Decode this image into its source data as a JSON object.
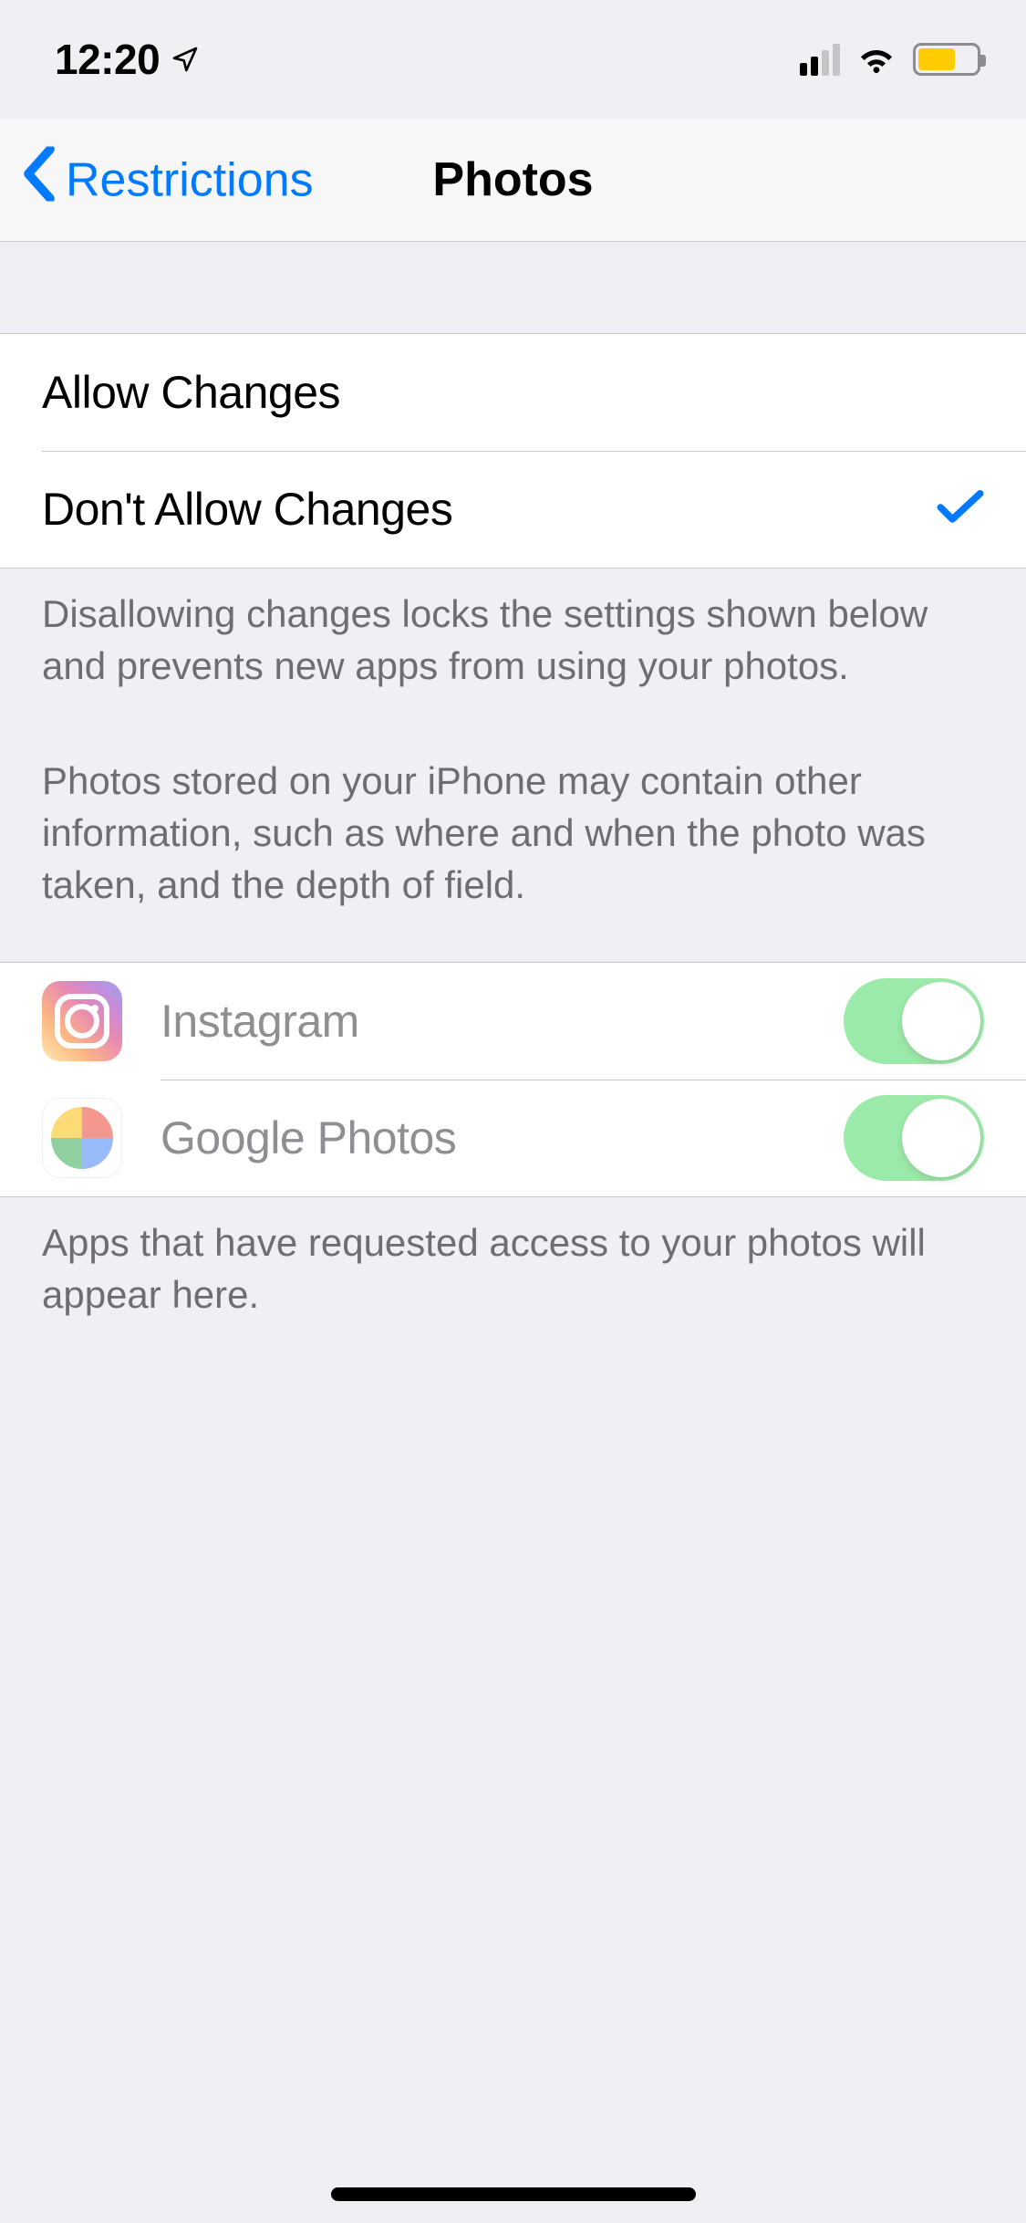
{
  "status": {
    "time": "12:20",
    "location_icon": "navigation-arrow",
    "signal_bars": 2,
    "wifi": true,
    "battery_state": "low-power"
  },
  "nav": {
    "back_label": "Restrictions",
    "title": "Photos"
  },
  "changes": {
    "allow_label": "Allow Changes",
    "dont_allow_label": "Don't Allow Changes",
    "selected": "dont_allow",
    "footer1": "Disallowing changes locks the settings shown below and prevents new apps from using your photos.",
    "footer2": "Photos stored on your iPhone may contain other information, such as where and when the photo was taken, and the depth of field."
  },
  "apps": [
    {
      "name": "Instagram",
      "icon": "instagram",
      "enabled": true
    },
    {
      "name": "Google Photos",
      "icon": "google-photos",
      "enabled": true
    }
  ],
  "apps_footer": "Apps that have requested access to your photos will appear here."
}
